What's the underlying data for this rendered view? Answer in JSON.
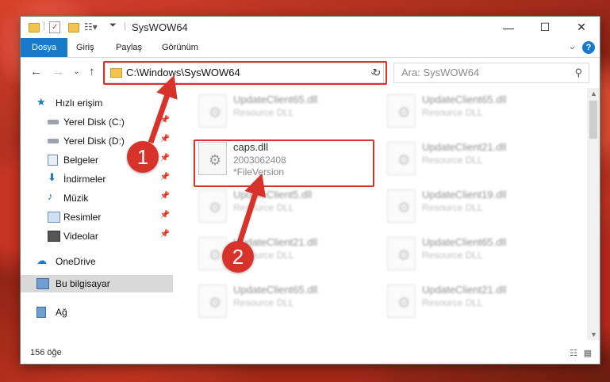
{
  "window": {
    "title": "SysWOW64",
    "controls": {
      "minimize": "—",
      "maximize": "☐",
      "close": "✕"
    }
  },
  "ribbon": {
    "tabs": [
      {
        "label": "Dosya",
        "active": true
      },
      {
        "label": "Giriş"
      },
      {
        "label": "Paylaş"
      },
      {
        "label": "Görünüm"
      }
    ],
    "help": "?"
  },
  "navigation": {
    "address": "C:\\Windows\\SysWOW64",
    "search_placeholder": "Ara: SysWOW64"
  },
  "sidebar": {
    "quick_access": "Hızlı erişim",
    "items": [
      {
        "label": "Yerel Disk (C:)",
        "icon": "drive-icon"
      },
      {
        "label": "Yerel Disk (D:)",
        "icon": "drive-icon"
      },
      {
        "label": "Belgeler",
        "icon": "documents-icon"
      },
      {
        "label": "İndirmeler",
        "icon": "downloads-icon"
      },
      {
        "label": "Müzik",
        "icon": "music-icon"
      },
      {
        "label": "Resimler",
        "icon": "pictures-icon"
      },
      {
        "label": "Videolar",
        "icon": "videos-icon"
      }
    ],
    "onedrive": "OneDrive",
    "this_pc": "Bu bilgisayar",
    "network": "Ağ"
  },
  "files": {
    "highlighted": {
      "name": "caps.dll",
      "version": "2003062408",
      "description": "*FileVersion"
    },
    "blurred": [
      {
        "name": "UpdateClient65.dll",
        "type": "Resource DLL"
      },
      {
        "name": "UpdateClient65.dll",
        "type": "Resource DLL"
      },
      {
        "name": "UpdateClient21.dll",
        "type": "Resource DLL"
      },
      {
        "name": "UpdateClient5.dll",
        "type": "Resource DLL"
      },
      {
        "name": "UpdateClient19.dll",
        "type": "Resource DLL"
      },
      {
        "name": "UpdateClient21.dll",
        "type": "Resource DLL"
      },
      {
        "name": "UpdateClient65.dll",
        "type": "Resource DLL"
      },
      {
        "name": "UpdateClient65.dll",
        "type": "Resource DLL"
      },
      {
        "name": "UpdateClient21.dll",
        "type": "Resource DLL"
      }
    ]
  },
  "status": {
    "item_count": "156 öğe"
  },
  "annotations": {
    "step1": "1",
    "step2": "2",
    "color": "#d8332b"
  }
}
